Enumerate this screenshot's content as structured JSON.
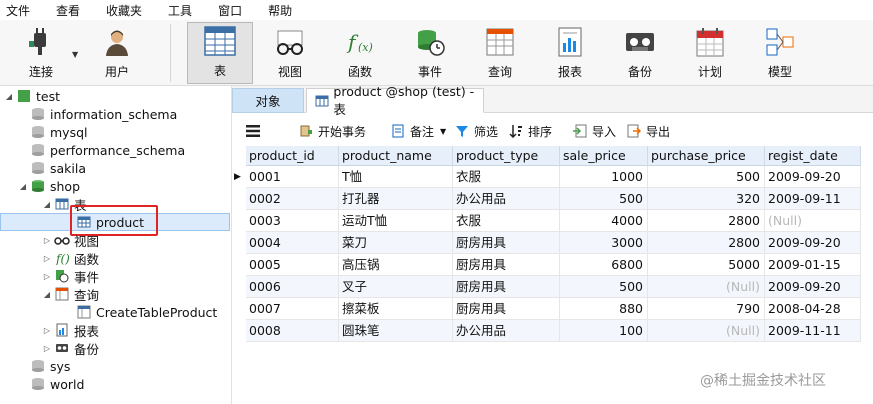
{
  "menubar": {
    "items": [
      "文件",
      "查看",
      "收藏夹",
      "工具",
      "窗口",
      "帮助"
    ]
  },
  "toolbar": {
    "connect_label": "连接",
    "user_label": "用户",
    "table_label": "表",
    "view_label": "视图",
    "function_label": "函数",
    "event_label": "事件",
    "query_label": "查询",
    "report_label": "报表",
    "backup_label": "备份",
    "schedule_label": "计划",
    "model_label": "模型"
  },
  "tree": {
    "connection": "test",
    "databases": [
      "information_schema",
      "mysql",
      "performance_schema",
      "sakila",
      "shop",
      "sys",
      "world"
    ],
    "shop": {
      "tables_label": "表",
      "selected_table": "product",
      "views_label": "视图",
      "functions_label": "函数",
      "events_label": "事件",
      "queries_label": "查询",
      "query_item": "CreateTableProduct",
      "reports_label": "报表",
      "backups_label": "备份"
    }
  },
  "tabs": {
    "objects": "对象",
    "active": "product @shop (test) - 表"
  },
  "subtoolbar": {
    "begin_tx": "开始事务",
    "note": "备注",
    "filter": "筛选",
    "sort": "排序",
    "import": "导入",
    "export": "导出"
  },
  "grid": {
    "columns": [
      "product_id",
      "product_name",
      "product_type",
      "sale_price",
      "purchase_price",
      "regist_date"
    ],
    "rows": [
      [
        "0001",
        "T恤",
        "衣服",
        "1000",
        "500",
        "2009-09-20"
      ],
      [
        "0002",
        "打孔器",
        "办公用品",
        "500",
        "320",
        "2009-09-11"
      ],
      [
        "0003",
        "运动T恤",
        "衣服",
        "4000",
        "2800",
        "(Null)"
      ],
      [
        "0004",
        "菜刀",
        "厨房用具",
        "3000",
        "2800",
        "2009-09-20"
      ],
      [
        "0005",
        "高压锅",
        "厨房用具",
        "6800",
        "5000",
        "2009-01-15"
      ],
      [
        "0006",
        "叉子",
        "厨房用具",
        "500",
        "(Null)",
        "2009-09-20"
      ],
      [
        "0007",
        "擦菜板",
        "厨房用具",
        "880",
        "790",
        "2008-04-28"
      ],
      [
        "0008",
        "圆珠笔",
        "办公用品",
        "100",
        "(Null)",
        "2009-11-11"
      ]
    ]
  },
  "watermark": "@稀土掘金技术社区",
  "colors": {
    "selection": "#dcebfb",
    "header": "#e7effa",
    "highlight_box": "#e02424",
    "null_text": "#b8b8b8"
  }
}
